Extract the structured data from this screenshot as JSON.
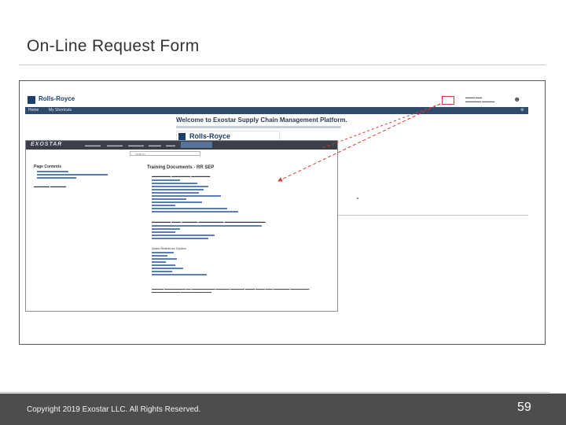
{
  "slide": {
    "title": "On-Line Request Form",
    "copyright": "Copyright 2019 Exostar LLC. All Rights Reserved.",
    "page_number": "59"
  },
  "rr_portal": {
    "logo_text": "Rolls-Royce",
    "welcome": "Welcome to Exostar Supply Chain Management Platform.",
    "brand_text": "Rolls-Royce",
    "nav_items": [
      "Home",
      "My Shortcuts"
    ]
  },
  "exostar": {
    "logo_text": "EXOSTAR",
    "search_placeholder": "Search",
    "left_heading": "Page Contents",
    "page_title": "Training Documents - RR SEP",
    "sections": [
      "Quick Reference Guides"
    ],
    "annotation_color": "#d43a3a"
  }
}
